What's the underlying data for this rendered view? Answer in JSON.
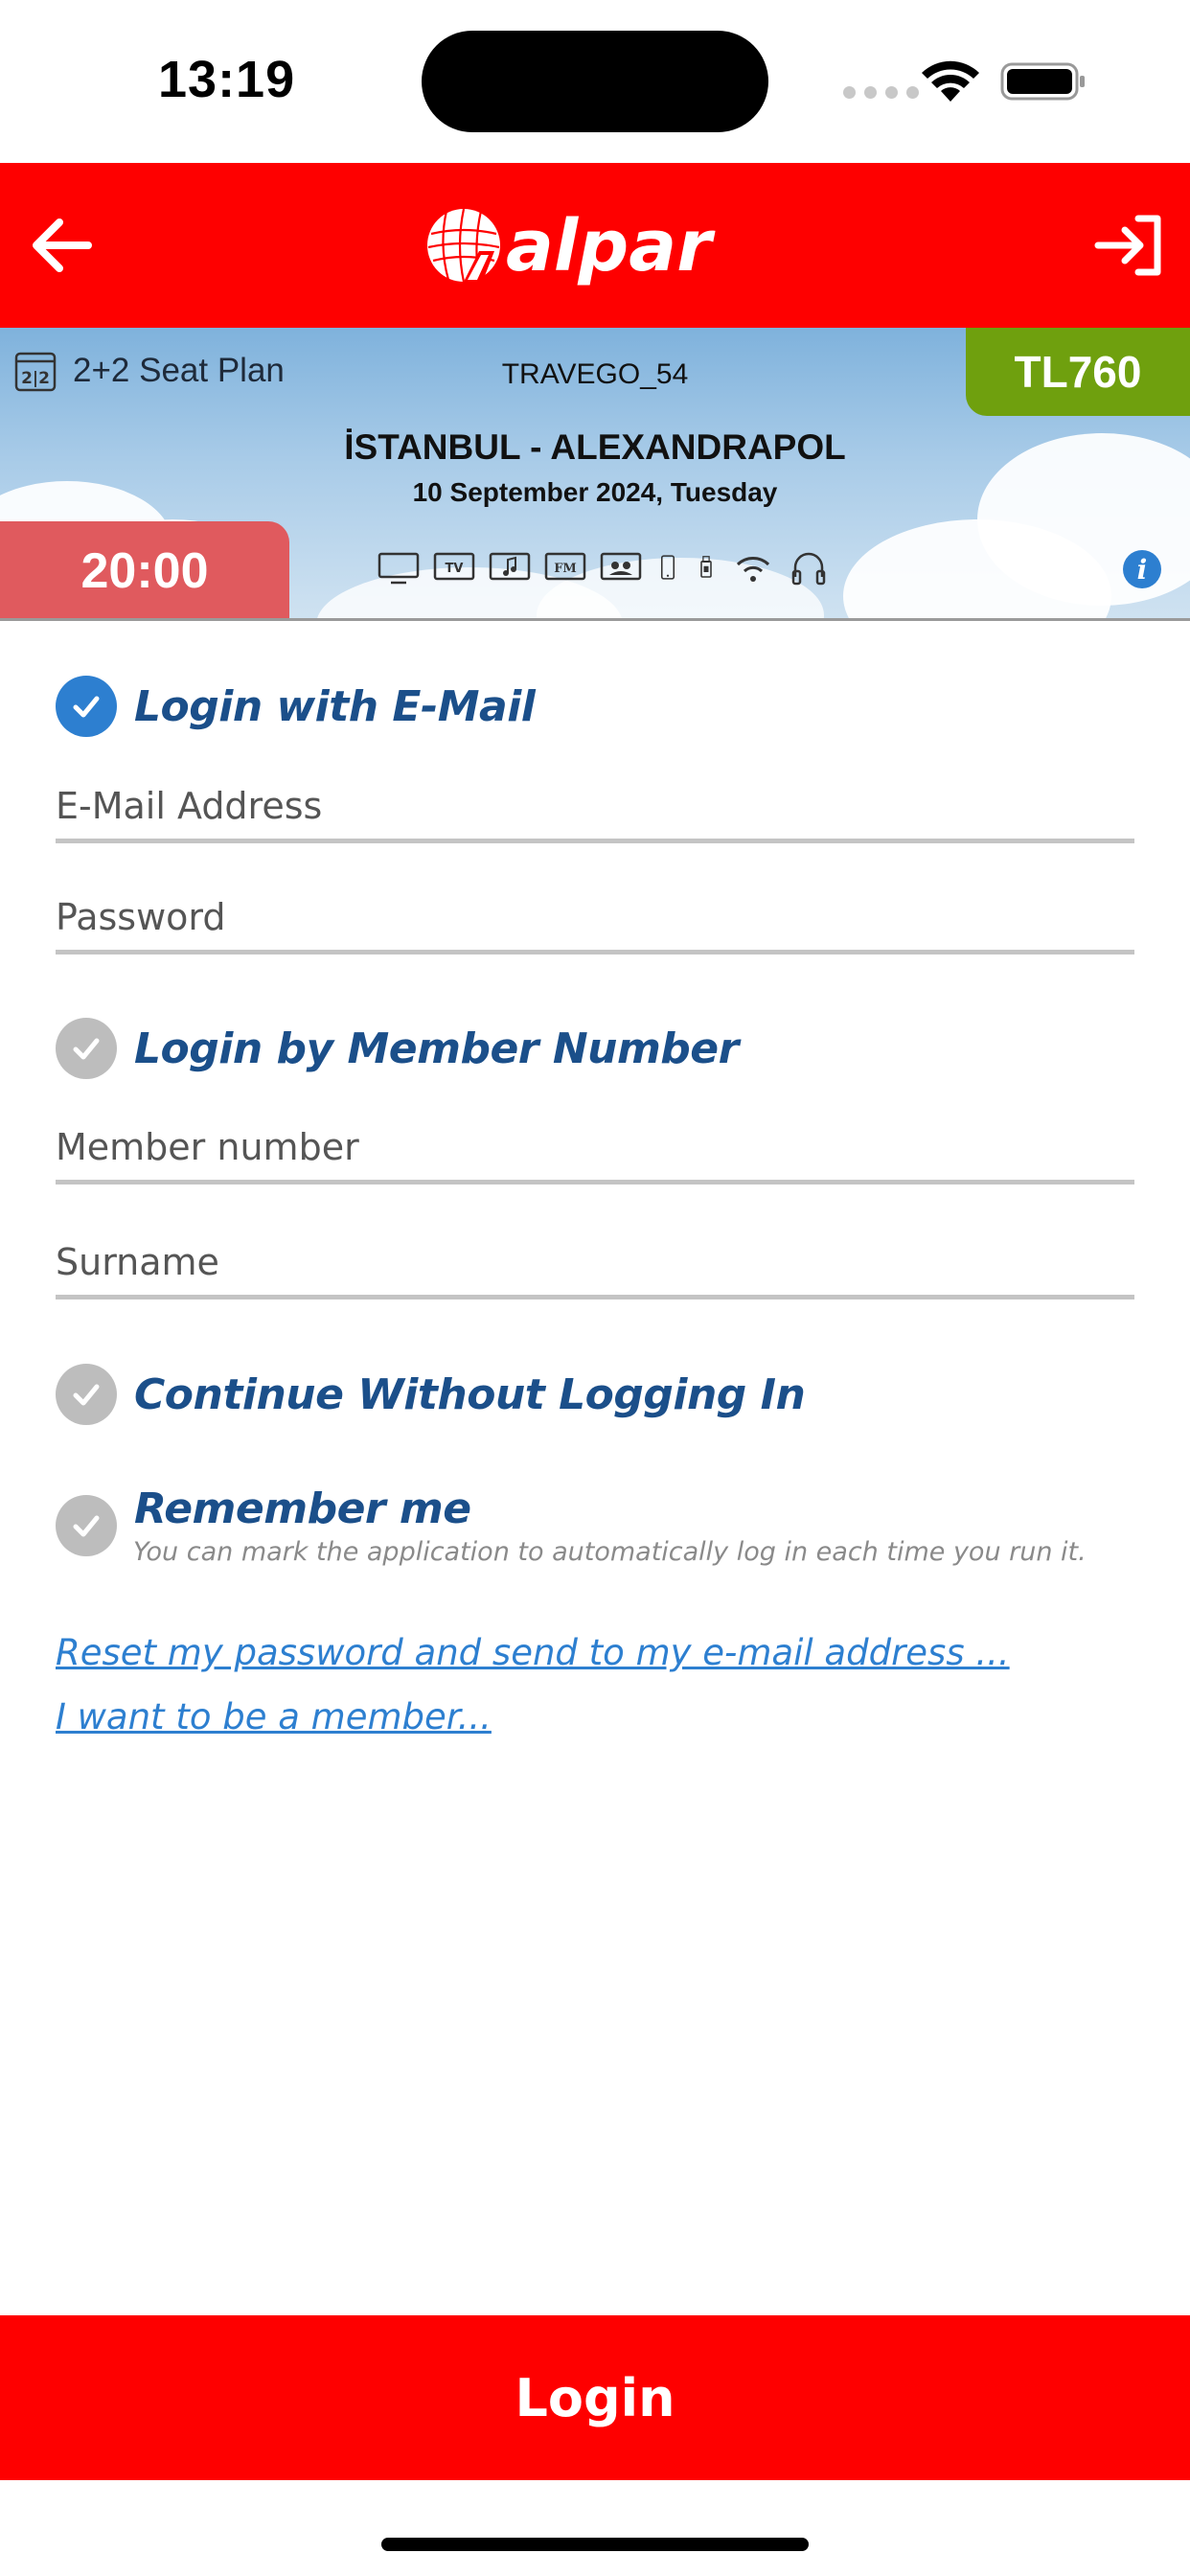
{
  "status_bar": {
    "time": "13:19"
  },
  "header": {
    "brand": "alpar",
    "back_icon": "arrow-left-icon",
    "login_icon": "sign-in-icon",
    "background_color": "#fe0000"
  },
  "trip": {
    "seat_plan_label": "2+2 Seat Plan",
    "seat_plan_icon_text": "2|2",
    "bus_model": "TRAVEGO_54",
    "route": "İSTANBUL - ALEXANDRAPOL",
    "date": "10 September 2024, Tuesday",
    "price": "TL760",
    "departure_time": "20:00",
    "amenities": [
      "monitor-icon",
      "tv-icon",
      "music-icon",
      "fm-radio-icon",
      "tv-group-icon",
      "phone-icon",
      "usb-icon",
      "wifi-icon",
      "headphones-icon"
    ],
    "amenity_labels": {
      "tv": "TV",
      "fm": "FM"
    },
    "info_icon_text": "i",
    "price_badge_color": "#6fa00e",
    "time_badge_color": "#e05a5e"
  },
  "form": {
    "email_option": {
      "label": "Login with E-Mail",
      "selected": true
    },
    "email_placeholder": "E-Mail Address",
    "password_placeholder": "Password",
    "member_option": {
      "label": "Login by Member Number",
      "selected": false
    },
    "member_number_placeholder": "Member number",
    "surname_placeholder": "Surname",
    "guest_option": {
      "label": "Continue Without Logging In",
      "selected": false
    },
    "remember_option": {
      "label": "Remember me",
      "hint": "You can mark the application to automatically log in each time you run it.",
      "selected": false
    },
    "reset_password_link": "Reset my password and send to my e-mail address ...",
    "become_member_link": "I want to be a member..."
  },
  "login_button": {
    "label": "Login"
  },
  "colors": {
    "accent_red": "#fe0000",
    "selected_blue": "#2d7fd0",
    "label_blue": "#1b4f8a",
    "unselected_gray": "#bdbdbd"
  }
}
